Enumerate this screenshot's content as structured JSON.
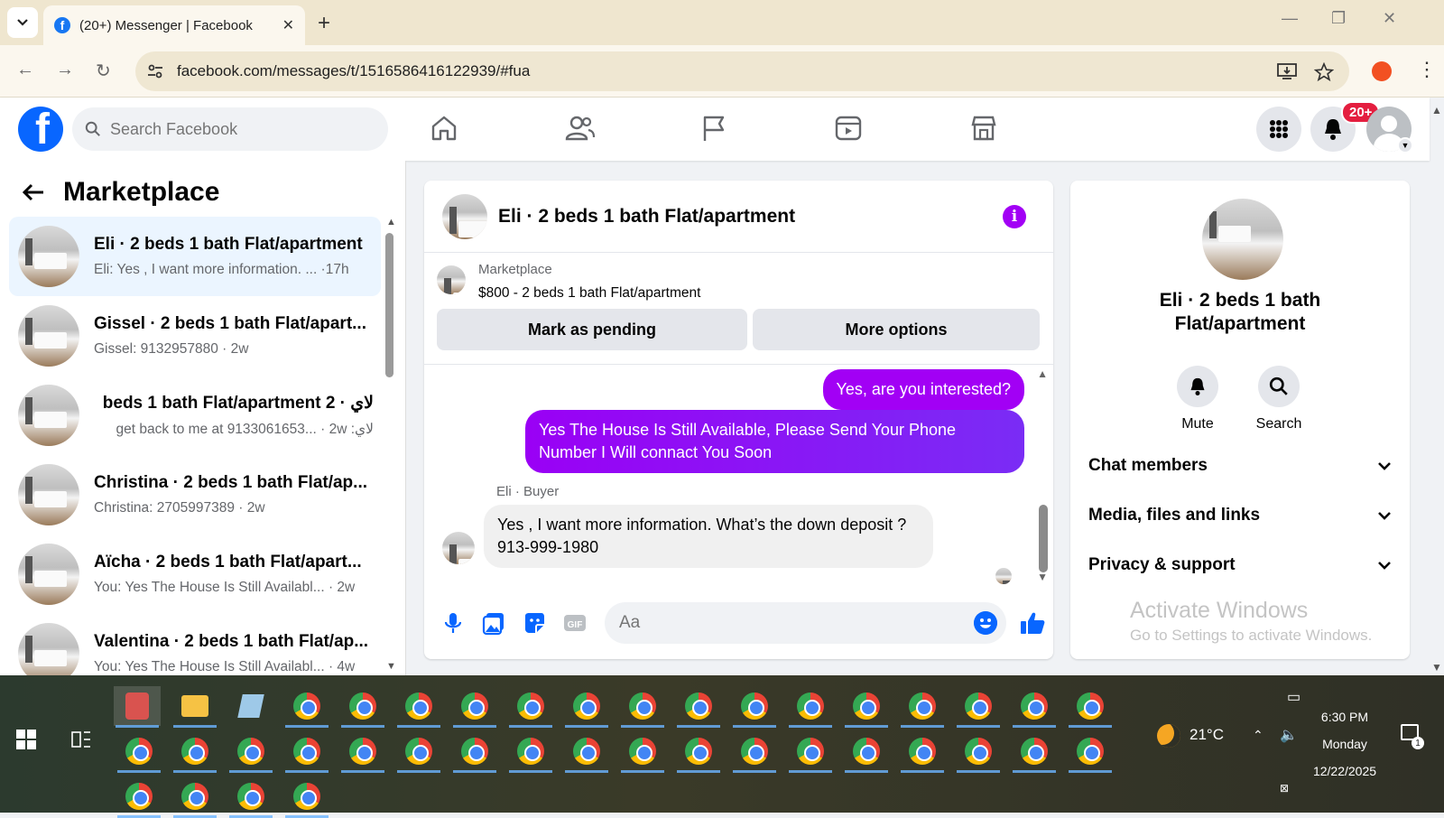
{
  "browser": {
    "tab_title": "(20+) Messenger | Facebook",
    "url": "facebook.com/messages/t/1516586416122939/#fua"
  },
  "fb": {
    "search_placeholder": "Search Facebook",
    "notification_badge": "20+",
    "colors": {
      "brand": "#0866ff",
      "outgoing": "#a200f5",
      "badge": "#e41e3f"
    }
  },
  "chatlist": {
    "title": "Marketplace",
    "items": [
      {
        "name": "Eli · 2 beds 1 bath Flat/apartment",
        "snippet": "Eli: Yes , I want more information. ... ·17h"
      },
      {
        "name": "Gissel · 2 beds 1 bath Flat/apart...",
        "snippet": "Gissel: 9132957880 · 2w"
      },
      {
        "name": "لاي · 2 beds 1 bath Flat/apartment",
        "snippet": "لاي: get back to me at 9133061653... · 2w"
      },
      {
        "name": "Christina · 2 beds 1 bath Flat/ap...",
        "snippet": "Christina: 2705997389 · 2w"
      },
      {
        "name": "Aïcha · 2 beds 1 bath Flat/apart...",
        "snippet": "You: Yes The House Is Still Availabl... · 2w"
      },
      {
        "name": "Valentina · 2 beds 1 bath Flat/ap...",
        "snippet": "You: Yes The House Is Still Availabl... · 4w"
      }
    ]
  },
  "conversation": {
    "title": "Eli · 2 beds 1 bath Flat/apartment",
    "marketplace_label": "Marketplace",
    "listing": "$800 - 2 beds 1 bath Flat/apartment",
    "mark_pending": "Mark as pending",
    "more_options": "More options",
    "messages": {
      "out1": "Yes, are you interested?",
      "out2": "Yes The House Is Still Available, Please Send Your Phone Number I Will connact You Soon",
      "sender_label": "Eli · Buyer",
      "in1": "Yes , I want more information. What’s the down deposit ? 913-999-1980"
    },
    "composer_placeholder": "Aa"
  },
  "info_panel": {
    "name": "Eli · 2 beds 1 bath Flat/apartment",
    "mute": "Mute",
    "search": "Search",
    "chat_members": "Chat members",
    "media": "Media, files and links",
    "privacy": "Privacy & support",
    "watermark_title": "Activate Windows",
    "watermark_sub": "Go to Settings to activate Windows."
  },
  "taskbar": {
    "weather": "21°C",
    "time": "6:30 PM",
    "day": "Monday",
    "date": "12/22/2025",
    "notifications": "1"
  }
}
